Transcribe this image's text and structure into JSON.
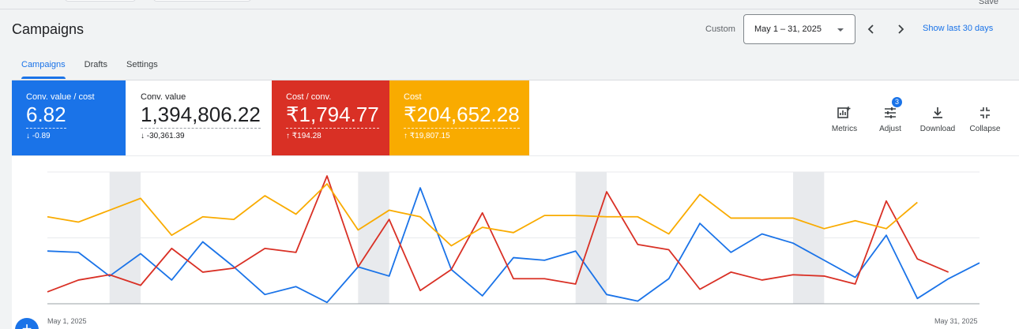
{
  "header": {
    "save_label": "Save",
    "title": "Campaigns",
    "custom_label": "Custom",
    "date_range": "May 1 – 31, 2025",
    "show_last": "Show last 30 days"
  },
  "tabs": [
    {
      "label": "Campaigns",
      "active": true
    },
    {
      "label": "Drafts",
      "active": false
    },
    {
      "label": "Settings",
      "active": false
    }
  ],
  "scorecards": [
    {
      "label": "Conv. value / cost",
      "value": "6.82",
      "delta": "-0.89",
      "direction": "down",
      "color": "#1a73e8",
      "text_color": "#ffffff"
    },
    {
      "label": "Conv. value",
      "value": "1,394,806.22",
      "delta": "-30,361.39",
      "direction": "down",
      "color": "#ffffff",
      "text_color": "#202124"
    },
    {
      "label": "Cost / conv.",
      "value": "₹1,794.77",
      "delta": "₹194.28",
      "direction": "up",
      "color": "#d93025",
      "text_color": "#ffffff"
    },
    {
      "label": "Cost",
      "value": "₹204,652.28",
      "delta": "₹19,807.15",
      "direction": "up",
      "color": "#f9ab00",
      "text_color": "#ffffff"
    }
  ],
  "tools": [
    {
      "label": "Metrics",
      "icon": "metrics-icon"
    },
    {
      "label": "Adjust",
      "icon": "adjust-icon",
      "badge": "3"
    },
    {
      "label": "Download",
      "icon": "download-icon"
    },
    {
      "label": "Collapse",
      "icon": "collapse-icon"
    }
  ],
  "chart_data": {
    "type": "line",
    "x_start_label": "May 1, 2025",
    "x_end_label": "May 31, 2025",
    "points": 31,
    "weekend_shaded_indices": [
      [
        2,
        3
      ],
      [
        10,
        11
      ],
      [
        17,
        18
      ],
      [
        24,
        25
      ]
    ],
    "series": [
      {
        "color": "#1a73e8",
        "values": [
          0.4,
          0.39,
          0.21,
          0.38,
          0.18,
          0.47,
          0.28,
          0.07,
          0.13,
          0.01,
          0.28,
          0.21,
          0.88,
          0.26,
          0.06,
          0.35,
          0.33,
          0.4,
          0.07,
          0.02,
          0.19,
          0.61,
          0.39,
          0.53,
          0.46,
          0.33,
          0.2,
          0.52,
          0.04,
          0.19,
          0.31
        ]
      },
      {
        "color": "#d93025",
        "values": [
          0.09,
          0.18,
          0.22,
          0.14,
          0.42,
          0.24,
          0.27,
          0.42,
          0.39,
          0.97,
          0.28,
          0.64,
          0.1,
          0.26,
          0.69,
          0.19,
          0.19,
          0.15,
          0.85,
          0.45,
          0.41,
          0.11,
          0.24,
          0.18,
          0.22,
          0.21,
          0.15,
          0.78,
          0.34,
          0.24
        ]
      },
      {
        "color": "#f9ab00",
        "values": [
          0.66,
          0.62,
          0.71,
          0.8,
          0.52,
          0.66,
          0.64,
          0.82,
          0.68,
          0.91,
          0.56,
          0.71,
          0.66,
          0.44,
          0.58,
          0.54,
          0.67,
          0.67,
          0.66,
          0.66,
          0.53,
          0.83,
          0.65,
          0.65,
          0.65,
          0.57,
          0.63,
          0.57,
          0.77
        ]
      }
    ]
  }
}
